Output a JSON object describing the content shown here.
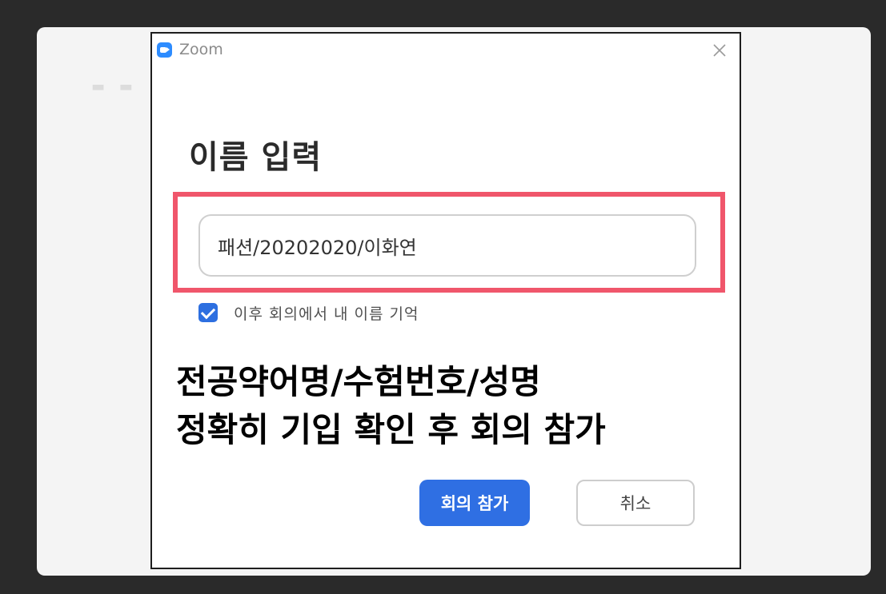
{
  "window": {
    "title": "Zoom",
    "logo_icon": "zoom-logo-icon",
    "close_icon": "close-icon"
  },
  "dialog": {
    "heading": "이름 입력",
    "name_value": "패션/20202020/이화연",
    "remember_checked": true,
    "remember_label": "이후 회의에서 내 이름 기억",
    "join_label": "회의 참가",
    "cancel_label": "취소"
  },
  "annotation": {
    "line1": "전공약어명/수험번호/성명",
    "line2": "정확히 기입 확인 후 회의 참가",
    "highlight_color": "#f0566b"
  },
  "colors": {
    "accent": "#2f6fe3",
    "checkbox": "#2d6fe0"
  }
}
